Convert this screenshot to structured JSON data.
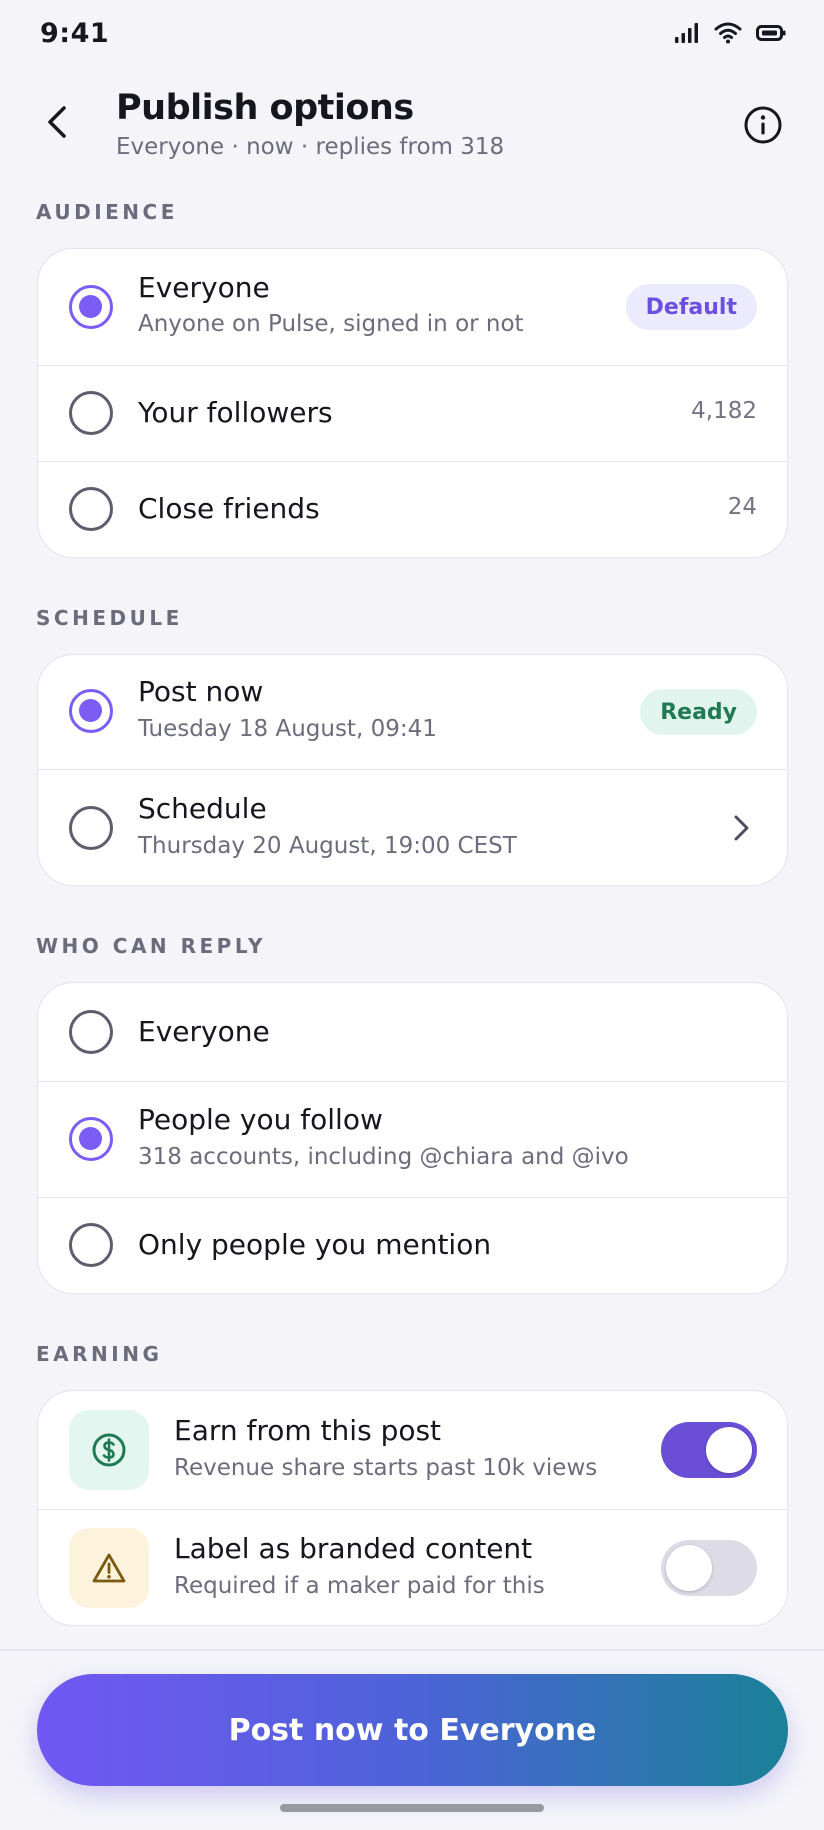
{
  "status_bar": {
    "time": "9:41"
  },
  "header": {
    "title": "Publish options",
    "subtitle": "Everyone · now · replies from 318"
  },
  "audience": {
    "label": "AUDIENCE",
    "options": [
      {
        "title": "Everyone",
        "subtitle": "Anyone on Pulse, signed in or not",
        "badge": "Default",
        "selected": true
      },
      {
        "title": "Your followers",
        "count": "4,182",
        "selected": false
      },
      {
        "title": "Close friends",
        "count": "24",
        "selected": false
      }
    ]
  },
  "schedule": {
    "label": "SCHEDULE",
    "options": [
      {
        "title": "Post now",
        "subtitle": "Tuesday 18 August, 09:41",
        "badge": "Ready",
        "selected": true
      },
      {
        "title": "Schedule",
        "subtitle": "Thursday 20 August, 19:00 CEST",
        "selected": false
      }
    ]
  },
  "reply": {
    "label": "WHO CAN REPLY",
    "options": [
      {
        "title": "Everyone",
        "selected": false
      },
      {
        "title": "People you follow",
        "subtitle": "318 accounts, including @chiara and @ivo",
        "selected": true
      },
      {
        "title": "Only people you mention",
        "selected": false
      }
    ]
  },
  "earning": {
    "label": "EARNING",
    "items": [
      {
        "title": "Earn from this post",
        "subtitle": "Revenue share starts past 10k views",
        "icon": "dollar-icon",
        "enabled": true
      },
      {
        "title": "Label as branded content",
        "subtitle": "Required if a maker paid for this",
        "icon": "warning-icon",
        "enabled": false
      }
    ]
  },
  "cta": {
    "label": "Post now to Everyone"
  },
  "colors": {
    "accent": "#7b5cf5",
    "ready": "#1f7a53",
    "toggle_on": "#6a4fd6"
  }
}
